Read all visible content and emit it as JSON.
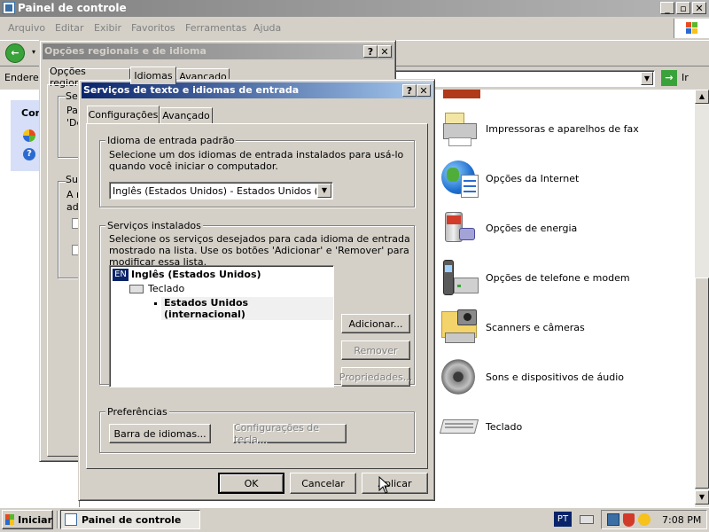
{
  "main_window": {
    "title": "Painel de controle",
    "menu": [
      "Arquivo",
      "Editar",
      "Exibir",
      "Favoritos",
      "Ferramentas",
      "Ajuda"
    ],
    "address_label": "Endereç",
    "go_label": "Ir",
    "side_panel_title": "Cont",
    "items": [
      {
        "label": "Impressoras e aparelhos de fax",
        "icon": "printer-icon"
      },
      {
        "label": "Opções da Internet",
        "icon": "internet-options-icon"
      },
      {
        "label": "Opções de energia",
        "icon": "power-options-icon"
      },
      {
        "label": "Opções de telefone e modem",
        "icon": "phone-modem-icon"
      },
      {
        "label": "Scanners e câmeras",
        "icon": "scanner-camera-icon"
      },
      {
        "label": "Sons e dispositivos de áudio",
        "icon": "sound-icon"
      },
      {
        "label": "Teclado",
        "icon": "keyboard-icon"
      }
    ]
  },
  "regional_dialog": {
    "title": "Opções regionais e de idioma",
    "tabs": [
      "Opções regionais",
      "Idiomas",
      "Avançado"
    ],
    "fragments": [
      "Se",
      "Pa",
      "'De",
      "Su",
      "A r",
      "adi"
    ]
  },
  "text_services_dialog": {
    "title": "Serviços de texto e idiomas de entrada",
    "tabs": [
      "Configurações",
      "Avançado"
    ],
    "default_lang_group": "Idioma de entrada padrão",
    "default_lang_desc": "Selecione um dos idiomas de entrada instalados para usá-lo quando você iniciar o computador.",
    "default_lang_value": "Inglês (Estados Unidos) - Estados Unidos (interna",
    "installed_group": "Serviços instalados",
    "installed_desc": "Selecione os serviços desejados para cada idioma de entrada mostrado na lista. Use os botões 'Adicionar' e 'Remover' para modificar essa lista.",
    "tree": {
      "lang_badge": "EN",
      "lang": "Inglês (Estados Unidos)",
      "category": "Teclado",
      "layout": "Estados Unidos (internacional)"
    },
    "buttons": {
      "add": "Adicionar...",
      "remove": "Remover",
      "properties": "Propriedades..."
    },
    "prefs_group": "Preferências",
    "lang_bar_btn": "Barra de idiomas...",
    "key_settings_btn": "Configurações de tecla...",
    "ok": "OK",
    "cancel": "Cancelar",
    "apply": "Aplicar"
  },
  "taskbar": {
    "start": "Iniciar",
    "task": "Painel de controle",
    "lang": "PT",
    "time": "7:08 PM"
  },
  "colors": {
    "title_active": "#0a246a",
    "title_inactive": "#808080",
    "face": "#d4d0c8"
  }
}
